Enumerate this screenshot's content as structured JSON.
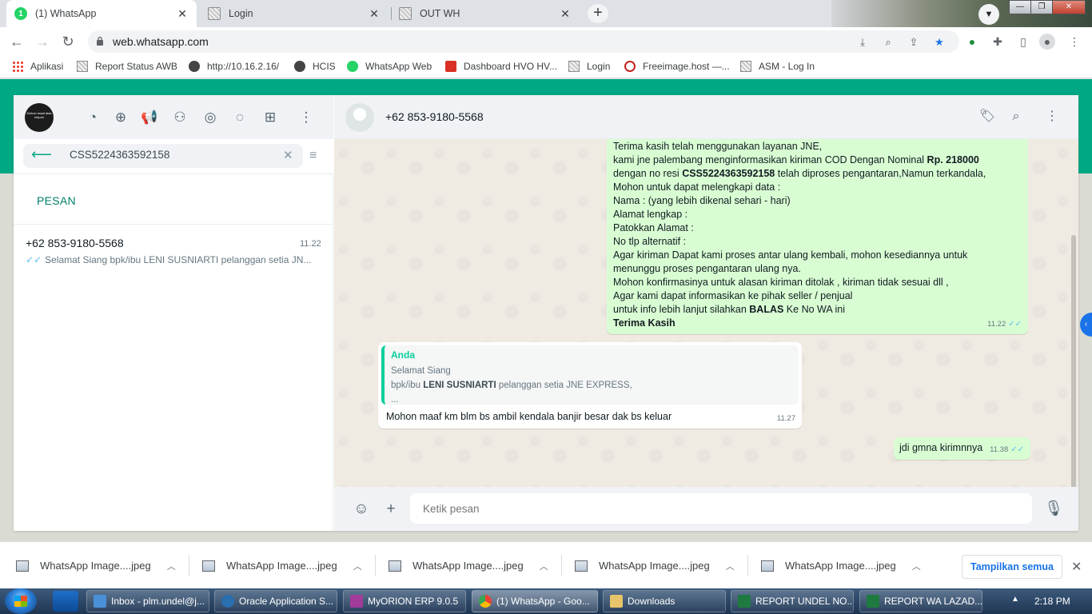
{
  "browser": {
    "tabs": [
      {
        "title": "(1) WhatsApp",
        "badge": "1"
      },
      {
        "title": "Login"
      },
      {
        "title": "OUT WH"
      }
    ],
    "new_tab": "+",
    "url": "web.whatsapp.com",
    "bookmarks": [
      "Aplikasi",
      "Report Status AWB",
      "http://10.16.2.16/",
      "HCIS",
      "WhatsApp Web",
      "Dashboard HVO HV...",
      "Login",
      "Freeimage.host —...",
      "ASM - Log In"
    ]
  },
  "whatsapp": {
    "search": {
      "value": "CSS5224363592158",
      "placeholder": ""
    },
    "section_label": "PESAN",
    "result": {
      "name": "+62 853-9180-5568",
      "time": "11.22",
      "preview": "Selamat Siang   bpk/ibu LENI SUSNIARTI pelanggan setia JN..."
    },
    "chat": {
      "contact": "+62 853-9180-5568",
      "msg1": {
        "line1": "Terima kasih telah menggunakan layanan JNE,",
        "line2a": "kami jne palembang menginformasikan kiriman  COD Dengan Nominal ",
        "line2b": "Rp. 218000",
        "line3a": "dengan no resi ",
        "line3b": "CSS5224363592158",
        "line3c": " telah diproses pengantaran,Namun terkandala,",
        "line4": "Mohon untuk dapat melengkapi data :",
        "line5": "Nama : (yang lebih dikenal sehari - hari)",
        "line6": "Alamat  lengkap :",
        "line7": "Patokkan Alamat :",
        "line8": "No tlp alternatif :",
        "line9": "Agar kiriman Dapat kami proses antar ulang kembali, mohon kesediannya untuk",
        "line10": "menunggu proses pengantaran ulang nya.",
        "line11": "Mohon konfirmasinya untuk alasan kiriman ditolak , kiriman tidak sesuai dll ,",
        "line12": "Agar kami dapat informasikan ke pihak seller / penjual",
        "line13a": "untuk info lebih lanjut silahkan ",
        "line13b": "BALAS",
        "line13c": " Ke No WA ini",
        "line14": "Terima Kasih",
        "time": "11.22"
      },
      "msg2": {
        "quote_author": "Anda",
        "quote_line1": "Selamat Siang",
        "quote_line2a": " bpk/ibu ",
        "quote_line2b": "LENI SUSNIARTI",
        "quote_line2c": " pelanggan setia JNE EXPRESS,",
        "quote_line3": " ...",
        "text": "Mohon maaf km blm bs ambil kendala banjir besar dak bs keluar",
        "time": "11.27"
      },
      "msg3": {
        "text": "jdi gmna kirimnnya",
        "time": "11.38"
      },
      "composer_placeholder": "Ketik pesan"
    }
  },
  "downloads": {
    "items": [
      "WhatsApp Image....jpeg",
      "WhatsApp Image....jpeg",
      "WhatsApp Image....jpeg",
      "WhatsApp Image....jpeg",
      "WhatsApp Image....jpeg"
    ],
    "show_all": "Tampilkan semua"
  },
  "taskbar": {
    "tasks": [
      "Inbox - plm.undel@j...",
      "Oracle Application S...",
      "MyORION ERP 9.0.5",
      "(1) WhatsApp - Goo...",
      "Downloads",
      "REPORT UNDEL NO...",
      "REPORT WA LAZAD..."
    ],
    "clock": "2:18 PM"
  },
  "colors": {
    "wa_green": "#00a884",
    "outgoing_bubble": "#d9fdd3",
    "read_ticks": "#53bdeb",
    "chrome_blue": "#1a73e8"
  }
}
